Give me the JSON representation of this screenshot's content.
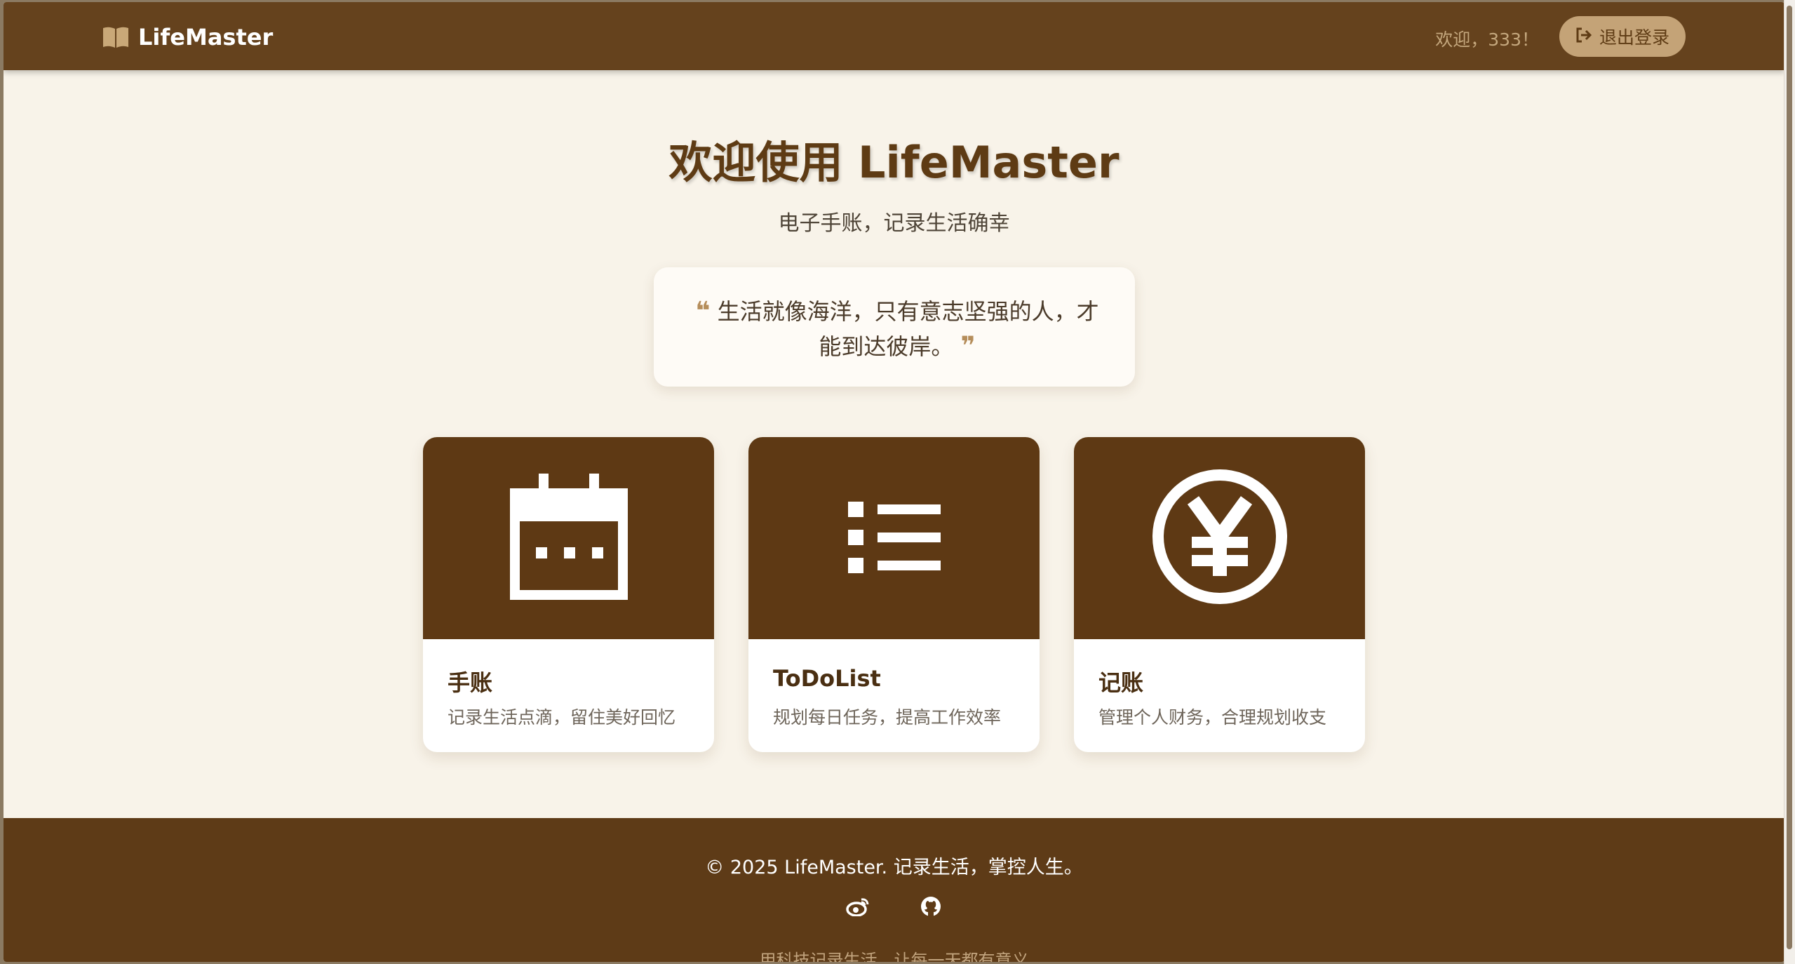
{
  "header": {
    "logo_text": "LifeMaster",
    "welcome_text": "欢迎，333！",
    "logout_label": "退出登录"
  },
  "main": {
    "title": "欢迎使用 LifeMaster",
    "subtitle": "电子手账，记录生活确幸",
    "quote_line1": "生活就像海洋，只有意志坚强的人，才",
    "quote_line2": "能到达彼岸。"
  },
  "cards": [
    {
      "title": "手账",
      "desc": "记录生活点滴，留住美好回忆",
      "icon": "calendar-icon"
    },
    {
      "title": "ToDoList",
      "desc": "规划每日任务，提高工作效率",
      "icon": "list-icon"
    },
    {
      "title": "记账",
      "desc": "管理个人财务，合理规划收支",
      "icon": "yen-circle-icon"
    }
  ],
  "footer": {
    "copyright": "© 2025 LifeMaster. 记录生活，掌控人生。",
    "slogan": "用科技记录生活，让每一天都有意义",
    "social_icons": [
      "weibo-icon",
      "github-icon"
    ]
  },
  "colors": {
    "header_bg": "#65421d",
    "accent": "#c4a377",
    "card_banner": "#5e3914",
    "page_bg": "#f8f3e9"
  }
}
